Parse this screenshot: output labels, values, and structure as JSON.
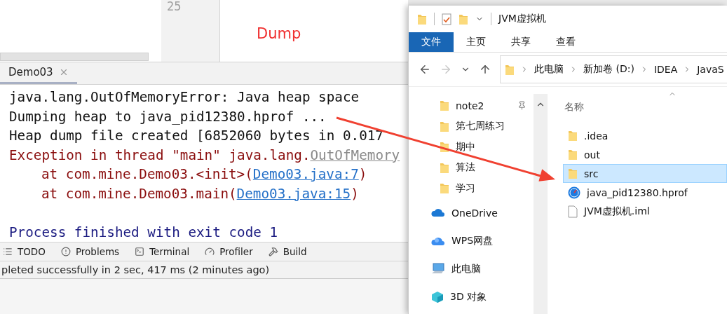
{
  "editor": {
    "line_number": "25",
    "annotation": "Dump"
  },
  "run_tab": {
    "label": "Demo03",
    "selected": true
  },
  "console": {
    "lines": [
      {
        "kind": "text",
        "indented": false,
        "segments": [
          {
            "kind": "out",
            "text": "java.lang.OutOfMemoryError: Java heap space"
          }
        ]
      },
      {
        "kind": "text",
        "indented": false,
        "segments": [
          {
            "kind": "out",
            "text": "Dumping heap to java_pid12380.hprof ..."
          }
        ]
      },
      {
        "kind": "text",
        "indented": false,
        "segments": [
          {
            "kind": "out",
            "text": "Heap dump file created [6852060 bytes in 0.017"
          }
        ]
      },
      {
        "kind": "text",
        "indented": false,
        "segments": [
          {
            "kind": "err",
            "text": "Exception in thread \"main\" java.lang."
          },
          {
            "kind": "dim_link",
            "text": "OutOfMemory"
          }
        ]
      },
      {
        "kind": "text",
        "indented": true,
        "segments": [
          {
            "kind": "err",
            "text": "at com.mine.Demo03.<init>("
          },
          {
            "kind": "link",
            "text": "Demo03.java:7"
          },
          {
            "kind": "err",
            "text": ")"
          }
        ]
      },
      {
        "kind": "text",
        "indented": true,
        "segments": [
          {
            "kind": "err",
            "text": "at com.mine.Demo03.main("
          },
          {
            "kind": "link",
            "text": "Demo03.java:15"
          },
          {
            "kind": "err",
            "text": ")"
          }
        ]
      },
      {
        "kind": "blank"
      },
      {
        "kind": "text",
        "indented": false,
        "segments": [
          {
            "kind": "info",
            "text": "Process finished with exit code 1"
          }
        ]
      }
    ]
  },
  "tool_tabs": [
    {
      "label": "TODO"
    },
    {
      "label": "Problems"
    },
    {
      "label": "Terminal"
    },
    {
      "label": "Profiler"
    },
    {
      "label": "Build"
    }
  ],
  "status_bar": "pleted successfully in 2 sec, 417 ms (2 minutes ago)",
  "explorer": {
    "title": "JVM虚拟机",
    "ribbon_tabs": [
      {
        "label": "文件",
        "selected": true
      },
      {
        "label": "主页",
        "selected": false
      },
      {
        "label": "共享",
        "selected": false
      },
      {
        "label": "查看",
        "selected": false
      }
    ],
    "address": [
      "此电脑",
      "新加卷 (D:)",
      "IDEA",
      "JavaS"
    ],
    "nav": [
      {
        "kind": "folder",
        "label": "note2",
        "pinned": true
      },
      {
        "kind": "folder",
        "label": "第七周练习",
        "pinned": false
      },
      {
        "kind": "folder",
        "label": "期中",
        "pinned": false
      },
      {
        "kind": "folder",
        "label": "算法",
        "pinned": false
      },
      {
        "kind": "folder",
        "label": "学习",
        "pinned": false
      },
      {
        "kind": "onedrive",
        "label": "OneDrive",
        "pinned": false
      },
      {
        "kind": "wps",
        "label": "WPS网盘",
        "pinned": false
      },
      {
        "kind": "computer",
        "label": "此电脑",
        "pinned": false
      },
      {
        "kind": "cube",
        "label": "3D 对象",
        "pinned": false
      }
    ],
    "column_header": "名称",
    "files": [
      {
        "kind": "folder",
        "name": ".idea",
        "selected": false
      },
      {
        "kind": "folder",
        "name": "out",
        "selected": false
      },
      {
        "kind": "folder",
        "name": "src",
        "selected": true
      },
      {
        "kind": "hprof",
        "name": "java_pid12380.hprof",
        "selected": false
      },
      {
        "kind": "file",
        "name": "JVM虚拟机.iml",
        "selected": false
      }
    ]
  }
}
